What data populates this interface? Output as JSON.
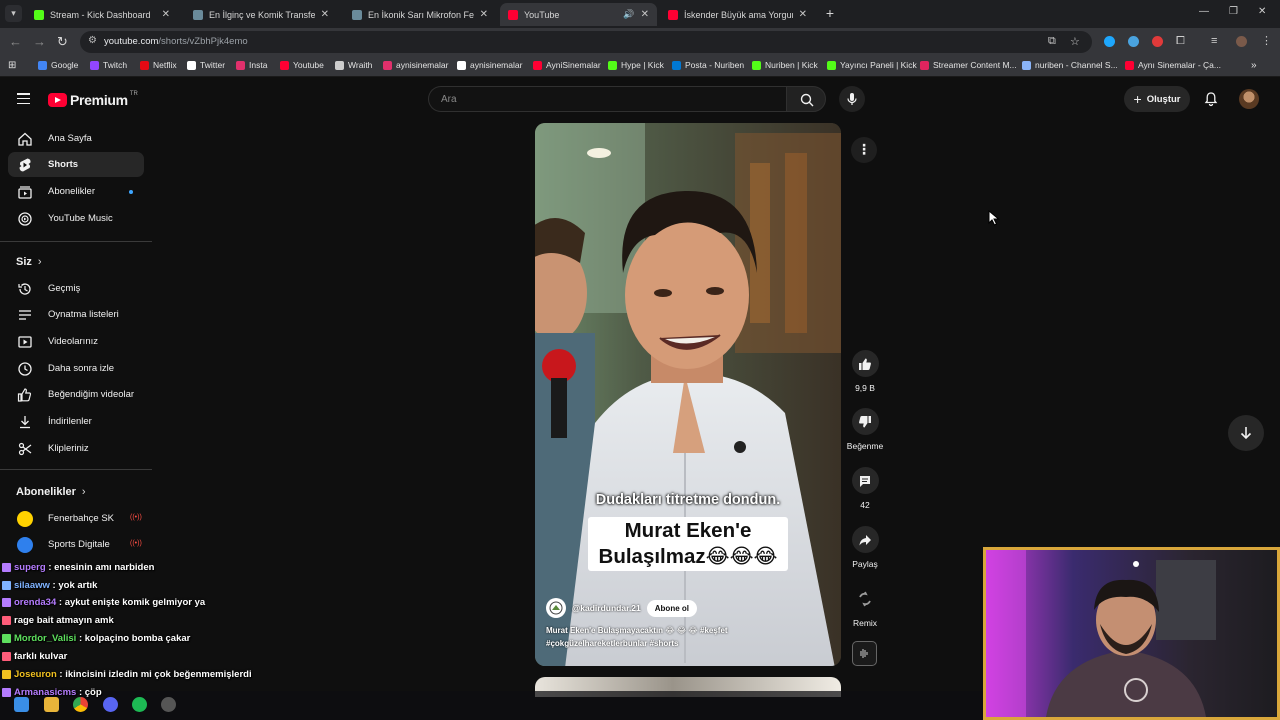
{
  "browser": {
    "tabs": [
      {
        "title": "Stream - Kick Dashboard",
        "fav_color": "#53fc18",
        "active": false
      },
      {
        "title": "En İlginç ve Komik Transfer Açık",
        "fav_color": "#6a8a9a",
        "active": false
      },
      {
        "title": "En İkonik Sarı Mikrofon Fenom",
        "fav_color": "#6a8a9a",
        "active": false
      },
      {
        "title": "YouTube",
        "fav_color": "#ff0033",
        "active": true
      },
      {
        "title": "İskender Büyük ama Yorgun.. (K",
        "fav_color": "#ff0033",
        "active": false
      }
    ],
    "url_host": "youtube.com",
    "url_path": "/shorts/vZbhPjk4emo",
    "bookmarks": [
      {
        "label": "Google",
        "color": "#4285f4"
      },
      {
        "label": "Twitch",
        "color": "#9146ff"
      },
      {
        "label": "Netflix",
        "color": "#e50914"
      },
      {
        "label": "Twitter",
        "color": "#ffffff"
      },
      {
        "label": "Insta",
        "color": "#e1306c"
      },
      {
        "label": "Youtube",
        "color": "#ff0033"
      },
      {
        "label": "Wraith",
        "color": "#cccccc"
      },
      {
        "label": "aynisinemalar",
        "color": "#e1306c"
      },
      {
        "label": "aynisinemalar",
        "color": "#ffffff"
      },
      {
        "label": "AyniSinemalar",
        "color": "#ff0033"
      },
      {
        "label": "Hype | Kick",
        "color": "#53fc18"
      },
      {
        "label": "Posta - Nuriben",
        "color": "#0078d4"
      },
      {
        "label": "Nuriben | Kick",
        "color": "#53fc18"
      },
      {
        "label": "Yayıncı Paneli | Kick",
        "color": "#53fc18"
      },
      {
        "label": "Streamer Content M...",
        "color": "#e0245e"
      },
      {
        "label": "nuriben - Channel S...",
        "color": "#8ab4f8"
      },
      {
        "label": "Aynı Sinemalar - Ça...",
        "color": "#ff0033"
      }
    ]
  },
  "youtube": {
    "logo_text": "Premium",
    "logo_country": "TR",
    "search_placeholder": "Ara",
    "create_label": "Oluştur",
    "sidebar_main": [
      {
        "label": "Ana Sayfa",
        "icon": "home-icon"
      },
      {
        "label": "Shorts",
        "icon": "shorts-icon",
        "active": true
      },
      {
        "label": "Abonelikler",
        "icon": "subscriptions-icon"
      },
      {
        "label": "YouTube Music",
        "icon": "music-icon"
      }
    ],
    "you_heading": "Siz",
    "sidebar_you": [
      {
        "label": "Geçmiş",
        "icon": "history-icon"
      },
      {
        "label": "Oynatma listeleri",
        "icon": "playlist-icon"
      },
      {
        "label": "Videolarınız",
        "icon": "your-videos-icon"
      },
      {
        "label": "Daha sonra izle",
        "icon": "watch-later-icon"
      },
      {
        "label": "Beğendiğim videolar",
        "icon": "liked-icon"
      },
      {
        "label": "İndirilenler",
        "icon": "download-icon"
      },
      {
        "label": "Klipleriniz",
        "icon": "clips-icon"
      }
    ],
    "subs_heading": "Abonelikler",
    "sidebar_subs": [
      {
        "label": "Fenerbahçe SK",
        "color": "#ffd200"
      },
      {
        "label": "Sports Digitale",
        "color": "#2f80ed"
      }
    ],
    "short": {
      "caption_top": "Dudakları titretme dondun.",
      "caption_line1": "Murat Eken'e",
      "caption_line2": "Bulaşılmaz😂😂😂",
      "channel": "@kadirdundar.21",
      "subscribe_label": "Abone ol",
      "description": "Murat Eken'e Bulaşmayacaktın 😂 😂 😂 #keşfet #çokgüzelhareketlerbunlar #shorts"
    },
    "actions": {
      "likes": "9,9 B",
      "dislike_label": "Beğenme",
      "comments": "42",
      "share_label": "Paylaş",
      "remix_label": "Remix"
    }
  },
  "chat": [
    {
      "user": "superg",
      "text": "enesinin amı narbiden",
      "color": "#b57cff"
    },
    {
      "user": "silaaww",
      "text": "yok artık",
      "color": "#7fb3ff"
    },
    {
      "user": "orenda34",
      "text": "aykut enişte komik gelmiyor ya",
      "color": "#b57cff"
    },
    {
      "user": "",
      "text": "rage bait atmayın amk",
      "color": "#ff5d7a"
    },
    {
      "user": "Mordor_Valisi",
      "text": "kolpaçino bomba çakar",
      "color": "#5ee05e"
    },
    {
      "user": "",
      "text": "farklı kulvar",
      "color": "#ff5d7a"
    },
    {
      "user": "Joseuron",
      "text": "ikincisini izledin mi çok beğenmemişlerdi",
      "color": "#f0c020"
    },
    {
      "user": "Armanasicms",
      "text": "çöp",
      "color": "#b57cff"
    }
  ]
}
